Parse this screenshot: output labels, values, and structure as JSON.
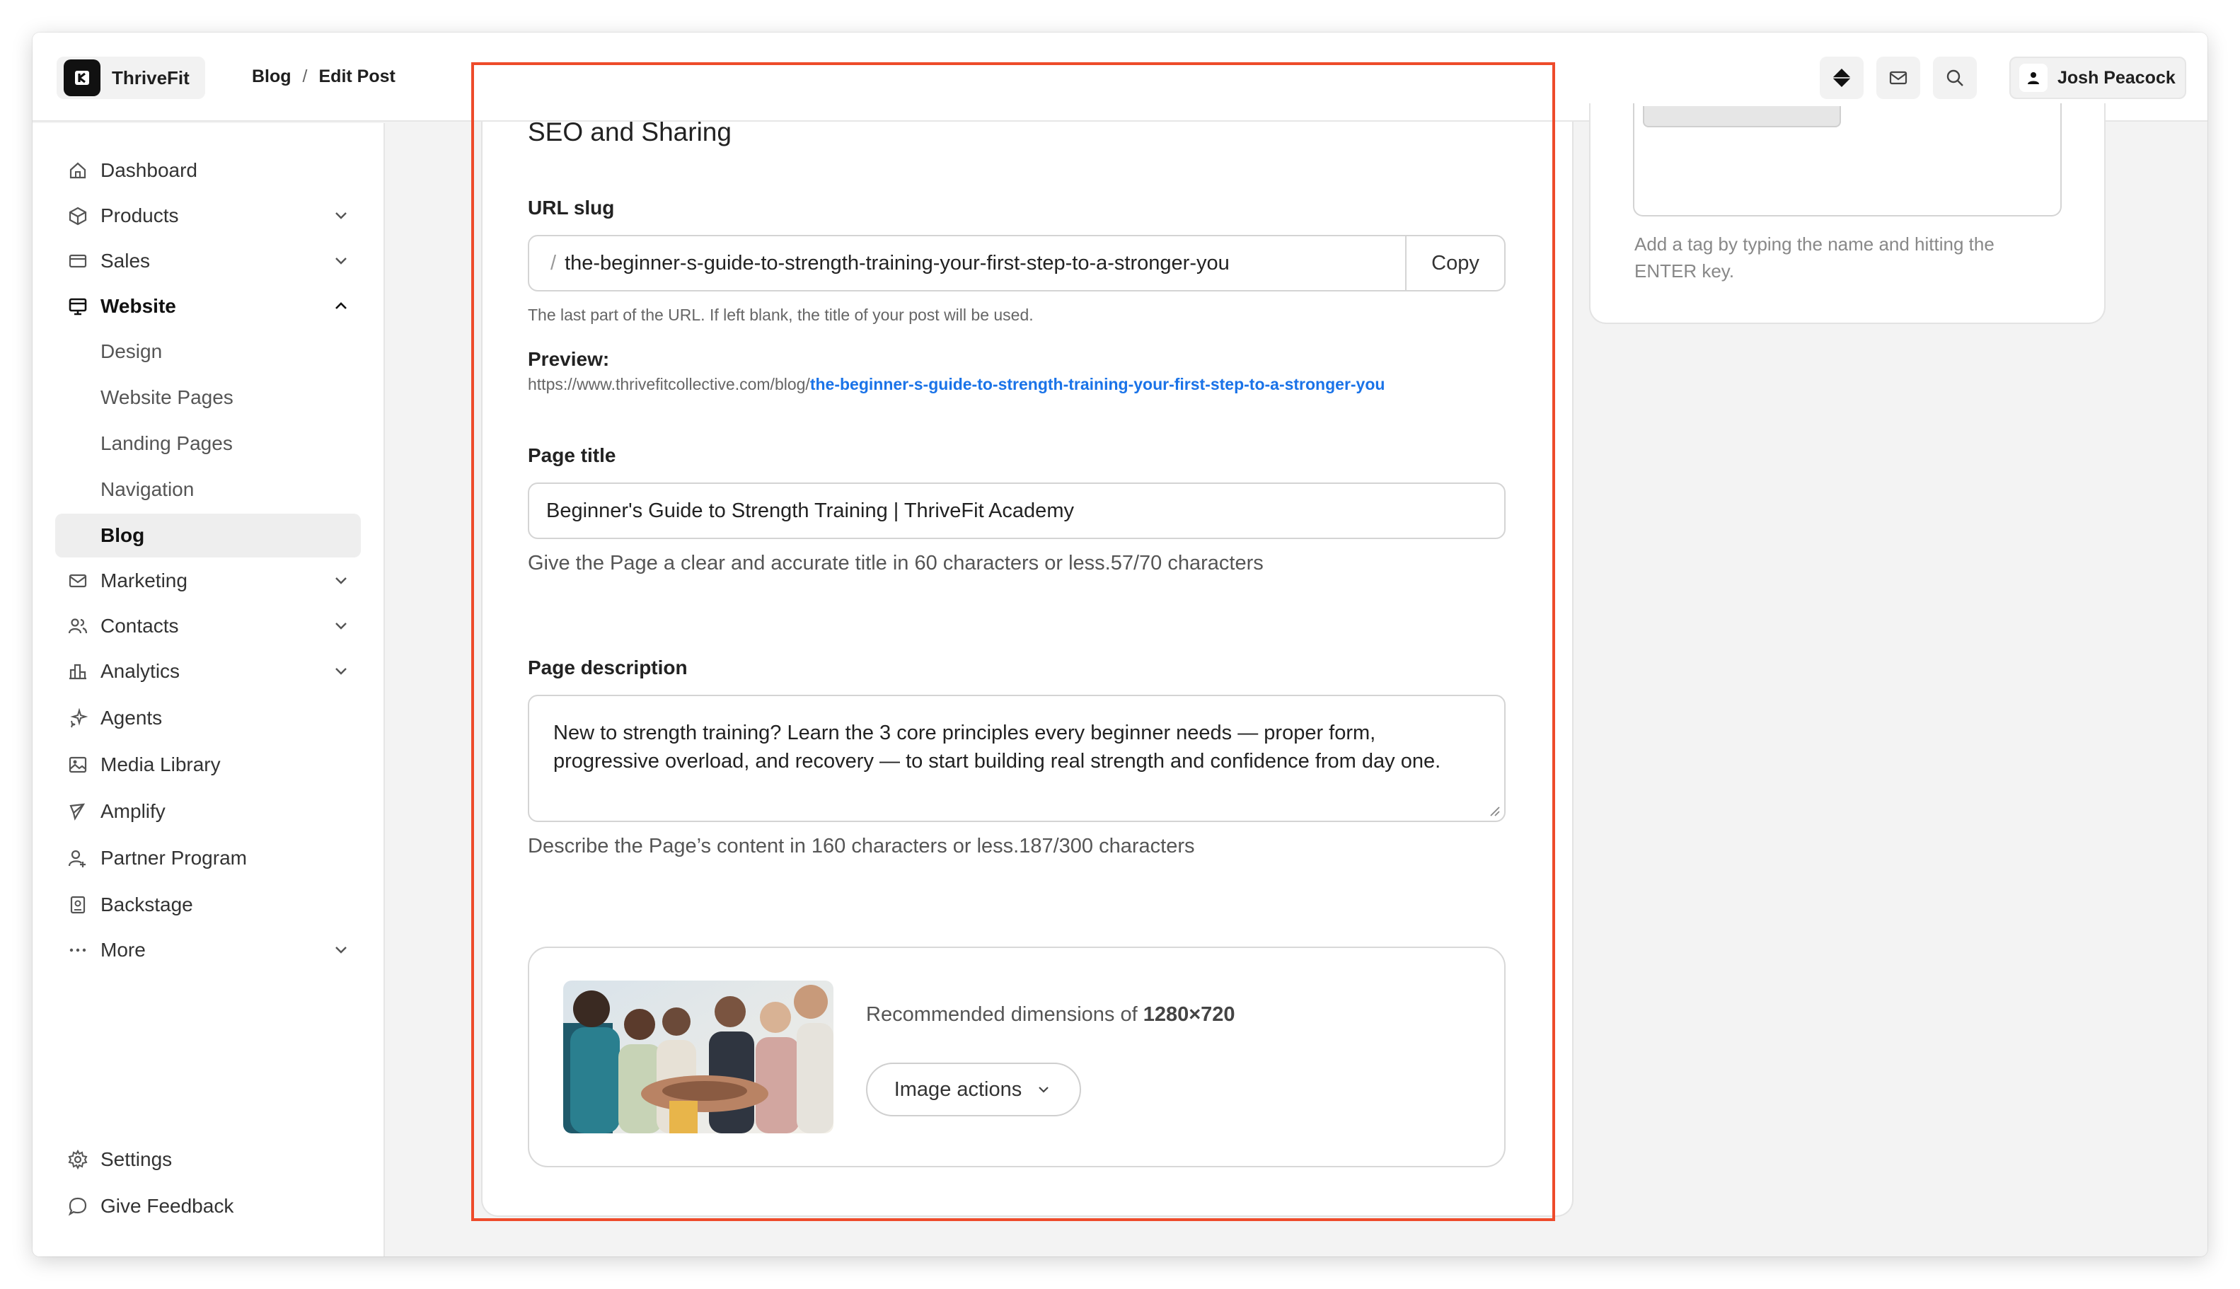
{
  "app": {
    "name": "ThriveFit",
    "breadcrumb": [
      "Blog",
      "/",
      "Edit Post"
    ],
    "user_name": "Josh Peacock"
  },
  "header_icons": [
    "diamond-icon",
    "mail-icon",
    "search-icon",
    "user-icon"
  ],
  "sidebar": {
    "items": [
      {
        "label": "Dashboard",
        "icon": "home-icon"
      },
      {
        "label": "Products",
        "icon": "box-icon",
        "expandable": true
      },
      {
        "label": "Sales",
        "icon": "card-icon",
        "expandable": true
      },
      {
        "label": "Website",
        "icon": "monitor-icon",
        "expanded": true
      },
      {
        "label": "Marketing",
        "icon": "mail-icon",
        "expandable": true
      },
      {
        "label": "Contacts",
        "icon": "users-icon",
        "expandable": true
      },
      {
        "label": "Analytics",
        "icon": "bar-chart-icon",
        "expandable": true
      },
      {
        "label": "Agents",
        "icon": "sparkle-icon"
      },
      {
        "label": "Media Library",
        "icon": "image-icon"
      },
      {
        "label": "Amplify",
        "icon": "megaphone-icon"
      },
      {
        "label": "Partner Program",
        "icon": "partner-icon"
      },
      {
        "label": "Backstage",
        "icon": "badge-icon"
      },
      {
        "label": "More",
        "icon": "dots-icon",
        "expandable": true
      }
    ],
    "website_sub": [
      "Design",
      "Website Pages",
      "Landing Pages",
      "Navigation",
      "Blog"
    ],
    "active_sub": "Blog",
    "footer": [
      {
        "label": "Settings",
        "icon": "gear-icon"
      },
      {
        "label": "Give Feedback",
        "icon": "chat-icon"
      }
    ]
  },
  "seo": {
    "title": "SEO and Sharing",
    "slug_label": "URL slug",
    "slug_prefix": "/",
    "slug_value": "the-beginner-s-guide-to-strength-training-your-first-step-to-a-stronger-you",
    "copy_label": "Copy",
    "slug_help": "The last part of the URL. If left blank, the title of your post will be used.",
    "preview_label": "Preview:",
    "preview_base": "https://www.thrivefitcollective.com/blog/",
    "preview_slug": "the-beginner-s-guide-to-strength-training-your-first-step-to-a-stronger-you",
    "page_title_label": "Page title",
    "page_title_value": "Beginner's Guide to Strength Training | ThriveFit Academy",
    "page_title_help": "Give the Page a clear and accurate title in 60 characters or less.57/70 characters",
    "page_desc_label": "Page description",
    "page_desc_value": "New to strength training? Learn the 3 core principles every beginner needs — proper form, progressive overload, and recovery — to start building real strength and confidence from day one.",
    "page_desc_help": "Describe the Page’s content in 160 characters or less.187/300 characters",
    "image_rec_prefix": "Recommended dimensions of",
    "image_rec_dims": "1280×720",
    "image_actions_label": "Image actions"
  },
  "tags": {
    "help": "Add a tag by typing the name and hitting the ENTER key."
  },
  "colors": {
    "accent_link": "#1a73e8",
    "highlight_outline": "#ee4b2b"
  }
}
